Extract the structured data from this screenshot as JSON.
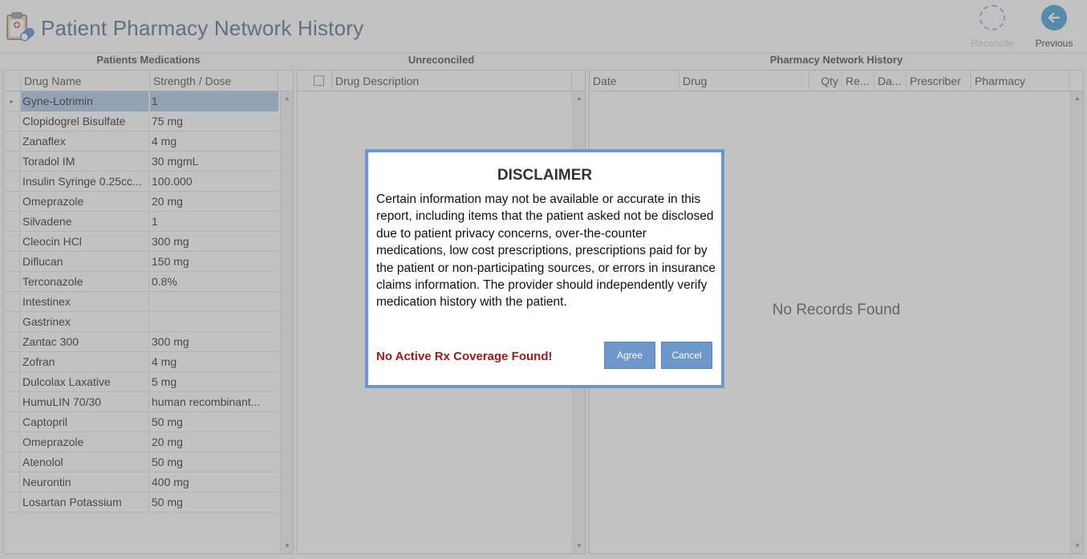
{
  "header": {
    "title": "Patient Pharmacy Network History",
    "reconcile_label": "Reconcile",
    "previous_label": "Previous"
  },
  "panels": {
    "medications": {
      "title": "Patients Medications",
      "columns": [
        "Drug Name",
        "Strength / Dose"
      ],
      "rows": [
        {
          "name": "Gyne-Lotrimin",
          "dose": "1",
          "selected": true
        },
        {
          "name": "Clopidogrel Bisulfate",
          "dose": "75 mg"
        },
        {
          "name": "Zanaflex",
          "dose": "4 mg"
        },
        {
          "name": "Toradol IM",
          "dose": "30 mgmL"
        },
        {
          "name": "Insulin Syringe 0.25cc...",
          "dose": "100.000"
        },
        {
          "name": "Omeprazole",
          "dose": "20 mg"
        },
        {
          "name": "Silvadene",
          "dose": "1"
        },
        {
          "name": "Cleocin HCl",
          "dose": "300 mg"
        },
        {
          "name": "Diflucan",
          "dose": "150 mg"
        },
        {
          "name": "Terconazole",
          "dose": "0.8%"
        },
        {
          "name": "Intestinex",
          "dose": ""
        },
        {
          "name": "Gastrinex",
          "dose": ""
        },
        {
          "name": "Zantac 300",
          "dose": "300 mg"
        },
        {
          "name": "Zofran",
          "dose": "4 mg"
        },
        {
          "name": "Dulcolax Laxative",
          "dose": "5 mg"
        },
        {
          "name": "HumuLIN 70/30",
          "dose": "human recombinant..."
        },
        {
          "name": "Captopril",
          "dose": "50 mg"
        },
        {
          "name": "Omeprazole",
          "dose": "20 mg"
        },
        {
          "name": "Atenolol",
          "dose": "50 mg"
        },
        {
          "name": "Neurontin",
          "dose": "400 mg"
        },
        {
          "name": "Losartan Potassium",
          "dose": "50 mg"
        }
      ]
    },
    "unreconciled": {
      "title": "Unreconciled",
      "columns": [
        "Drug Description"
      ]
    },
    "history": {
      "title": "Pharmacy Network History",
      "columns": [
        "Date",
        "Drug",
        "Qty",
        "Re...",
        "Da...",
        "Prescriber",
        "Pharmacy"
      ],
      "empty_text": "No Records Found"
    }
  },
  "dialog": {
    "title": "DISCLAIMER",
    "body": "Certain information may not be available or accurate in this report, including items that the patient asked not be disclosed due to patient privacy concerns, over-the-counter medications, low cost prescriptions, prescriptions paid for by the patient or non-participating sources, or errors in insurance claims information. The provider should independently verify medication history with the patient.",
    "warning": "No Active Rx Coverage Found!",
    "agree_label": "Agree",
    "cancel_label": "Cancel"
  },
  "colors": {
    "accent": "#6d97d2",
    "warning": "#a01c1c",
    "selected_row": "#a9c5e3"
  }
}
